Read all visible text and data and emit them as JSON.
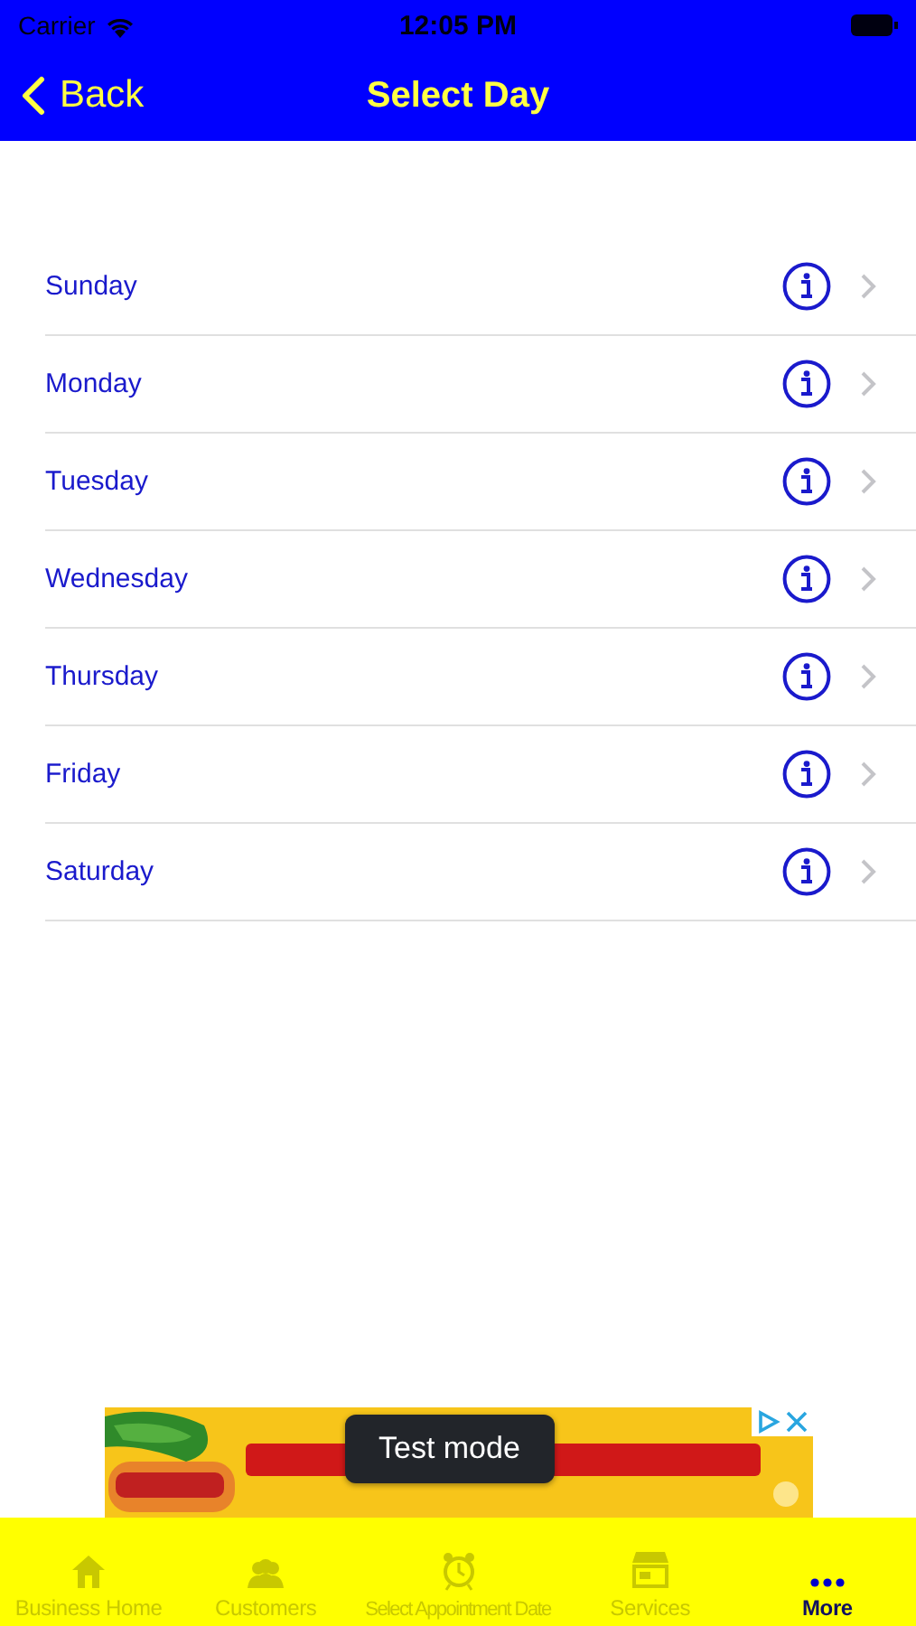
{
  "status_bar": {
    "carrier": "Carrier",
    "time": "12:05 PM"
  },
  "nav_bar": {
    "back": "Back",
    "title": "Select Day"
  },
  "days": [
    {
      "label": "Sunday"
    },
    {
      "label": "Monday"
    },
    {
      "label": "Tuesday"
    },
    {
      "label": "Wednesday"
    },
    {
      "label": "Thursday"
    },
    {
      "label": "Friday"
    },
    {
      "label": "Saturday"
    }
  ],
  "ad": {
    "kind": "picture",
    "badge": "Test mode"
  },
  "tabs": [
    {
      "label": "Business Home",
      "selected": false
    },
    {
      "label": "Customers",
      "selected": false
    },
    {
      "label": "Select Appointment Date",
      "selected": false
    },
    {
      "label": "Services",
      "selected": false
    },
    {
      "label": "More",
      "selected": true
    }
  ]
}
